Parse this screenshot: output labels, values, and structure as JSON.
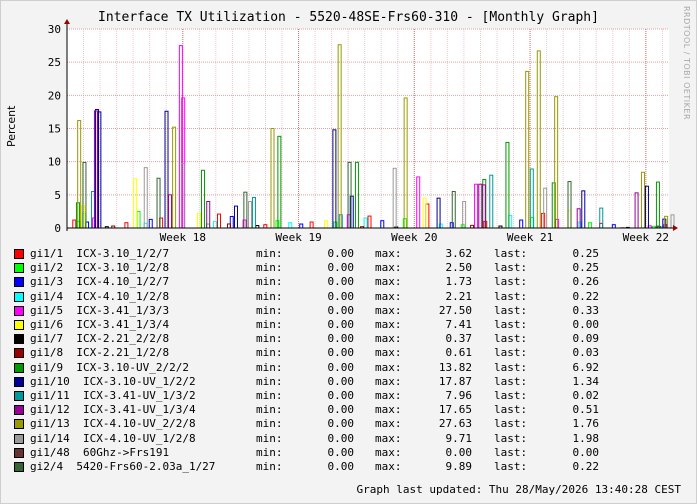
{
  "title": "Interface TX Utilization - 5520-48SE-Frs60-310 - [Monthly Graph]",
  "watermark": "RRDTOOL / TOBI OETIKER",
  "updated": "Graph last updated: Thu 28/May/2026 13:40:28 CEST",
  "chart_data": {
    "type": "bar",
    "ylabel": "Percent",
    "ylim": [
      0,
      30
    ],
    "yticks": [
      0,
      5,
      10,
      15,
      20,
      25,
      30
    ],
    "xlim": [
      17.0,
      22.2
    ],
    "xticks": [
      {
        "label": "Week 18",
        "pos": 18.0
      },
      {
        "label": "Week 19",
        "pos": 19.0
      },
      {
        "label": "Week 20",
        "pos": 20.0
      },
      {
        "label": "Week 21",
        "pos": 21.0
      },
      {
        "label": "Week 22",
        "pos": 22.0
      }
    ],
    "grid": true,
    "series": [
      {
        "name": "gi1/1  ICX-3.10_1/2/7",
        "color": "#ff0000",
        "stats": {
          "min": "0.00",
          "max": "3.62",
          "last": "0.25"
        },
        "points": [
          [
            17.05,
            1.2
          ],
          [
            17.5,
            0.8
          ],
          [
            17.8,
            1.5
          ],
          [
            18.3,
            2.1
          ],
          [
            18.7,
            0.5
          ],
          [
            19.1,
            0.9
          ],
          [
            19.6,
            1.8
          ],
          [
            20.1,
            3.62
          ],
          [
            20.6,
            1.0
          ],
          [
            21.1,
            2.2
          ],
          [
            21.6,
            0.7
          ],
          [
            22.1,
            0.25
          ]
        ]
      },
      {
        "name": "gi1/2  ICX-3.10_1/2/8",
        "color": "#00ff00",
        "stats": {
          "min": "0.00",
          "max": "2.50",
          "last": "0.25"
        },
        "points": [
          [
            17.08,
            1.0
          ],
          [
            17.6,
            2.5
          ],
          [
            18.2,
            0.6
          ],
          [
            18.8,
            1.1
          ],
          [
            19.3,
            0.9
          ],
          [
            19.9,
            1.4
          ],
          [
            20.4,
            0.5
          ],
          [
            21.0,
            1.6
          ],
          [
            21.5,
            0.8
          ],
          [
            22.05,
            0.25
          ]
        ]
      },
      {
        "name": "gi1/3  ICX-4.10_1/2/7",
        "color": "#0000ff",
        "stats": {
          "min": "0.00",
          "max": "1.73",
          "last": "0.26"
        },
        "points": [
          [
            17.15,
            0.9
          ],
          [
            17.7,
            1.3
          ],
          [
            18.4,
            1.73
          ],
          [
            19.0,
            0.6
          ],
          [
            19.7,
            1.1
          ],
          [
            20.3,
            0.8
          ],
          [
            20.9,
            1.2
          ],
          [
            21.7,
            0.5
          ],
          [
            22.08,
            0.26
          ]
        ]
      },
      {
        "name": "gi1/4  ICX-4.10_1/2/8",
        "color": "#00ffff",
        "stats": {
          "min": "0.00",
          "max": "2.21",
          "last": "0.22"
        },
        "points": [
          [
            17.12,
            2.21
          ],
          [
            17.65,
            0.7
          ],
          [
            18.25,
            1.0
          ],
          [
            18.9,
            0.8
          ],
          [
            19.55,
            1.5
          ],
          [
            20.2,
            0.6
          ],
          [
            20.8,
            1.9
          ],
          [
            21.4,
            0.9
          ],
          [
            22.12,
            0.22
          ]
        ]
      },
      {
        "name": "gi1/5  ICX-3.41_1/3/3",
        "color": "#ff00ff",
        "stats": {
          "min": "0.00",
          "max": "27.50",
          "last": "0.33"
        },
        "points": [
          [
            17.2,
            1.5
          ],
          [
            17.95,
            27.5
          ],
          [
            17.97,
            19.6
          ],
          [
            18.5,
            1.2
          ],
          [
            19.4,
            2.0
          ],
          [
            20.0,
            7.7
          ],
          [
            20.5,
            6.6
          ],
          [
            21.2,
            1.3
          ],
          [
            22.0,
            0.33
          ]
        ]
      },
      {
        "name": "gi1/6  ICX-3.41_1/3/4",
        "color": "#ffff00",
        "stats": {
          "min": "0.00",
          "max": "7.41",
          "last": "0.00"
        },
        "points": [
          [
            17.1,
            3.4
          ],
          [
            17.55,
            7.41
          ],
          [
            18.1,
            2.2
          ],
          [
            19.2,
            1.1
          ],
          [
            20.05,
            4.5
          ],
          [
            21.3,
            2.6
          ],
          [
            21.9,
            0.0
          ]
        ]
      },
      {
        "name": "gi1/7  ICX-2.21_2/2/8",
        "color": "#000000",
        "stats": {
          "min": "0.00",
          "max": "0.37",
          "last": "0.09"
        },
        "points": [
          [
            17.3,
            0.2
          ],
          [
            18.6,
            0.37
          ],
          [
            19.8,
            0.15
          ],
          [
            20.7,
            0.3
          ],
          [
            21.8,
            0.09
          ]
        ]
      },
      {
        "name": "gi1/8  ICX-2.21_1/2/8",
        "color": "#990000",
        "stats": {
          "min": "0.00",
          "max": "0.61",
          "last": "0.03"
        },
        "points": [
          [
            17.35,
            0.3
          ],
          [
            18.35,
            0.61
          ],
          [
            19.5,
            0.2
          ],
          [
            20.45,
            0.4
          ],
          [
            21.75,
            0.03
          ]
        ]
      },
      {
        "name": "gi1/9  ICX-3.10-UV_2/2/2",
        "color": "#009900",
        "stats": {
          "min": "0.00",
          "max": "13.82",
          "last": "6.92"
        },
        "points": [
          [
            17.04,
            3.8
          ],
          [
            18.12,
            8.7
          ],
          [
            18.78,
            13.82
          ],
          [
            19.45,
            9.9
          ],
          [
            20.55,
            7.3
          ],
          [
            20.75,
            12.9
          ],
          [
            21.15,
            6.8
          ],
          [
            22.05,
            6.92
          ]
        ]
      },
      {
        "name": "gi1/10  ICX-3.10-UV_1/2/2",
        "color": "#000099",
        "stats": {
          "min": "0.00",
          "max": "17.87",
          "last": "1.34",
          "": ""
        },
        "points": [
          [
            17.2,
            17.87
          ],
          [
            17.22,
            17.5
          ],
          [
            17.8,
            17.6
          ],
          [
            18.4,
            3.3
          ],
          [
            19.25,
            14.8
          ],
          [
            19.4,
            4.8
          ],
          [
            20.15,
            4.5
          ],
          [
            21.4,
            5.6
          ],
          [
            21.95,
            6.3
          ],
          [
            22.1,
            1.34
          ]
        ]
      },
      {
        "name": "gi1/11  ICX-3.41-UV_1/3/2",
        "color": "#009999",
        "stats": {
          "min": "0.00",
          "max": "7.96",
          "last": "0.02"
        },
        "points": [
          [
            17.16,
            5.5
          ],
          [
            18.55,
            4.6
          ],
          [
            19.3,
            2.0
          ],
          [
            20.6,
            7.96
          ],
          [
            20.95,
            8.9
          ],
          [
            21.55,
            3.0
          ],
          [
            22.15,
            0.02
          ]
        ]
      },
      {
        "name": "gi1/12  ICX-3.41-UV_1/3/4",
        "color": "#990099",
        "stats": {
          "min": "0.00",
          "max": "17.65",
          "last": "0.51"
        },
        "points": [
          [
            17.18,
            17.65
          ],
          [
            17.82,
            5.0
          ],
          [
            18.15,
            4.0
          ],
          [
            20.5,
            6.6
          ],
          [
            20.53,
            6.5
          ],
          [
            21.35,
            2.9
          ],
          [
            21.85,
            5.3
          ],
          [
            22.1,
            0.51
          ]
        ]
      },
      {
        "name": "gi1/13  ICX-4.10-UV_2/2/8",
        "color": "#999900",
        "stats": {
          "min": "0.00",
          "max": "27.63",
          "last": "1.76"
        },
        "points": [
          [
            17.03,
            16.2
          ],
          [
            17.85,
            15.2
          ],
          [
            18.7,
            15.0
          ],
          [
            19.28,
            27.63
          ],
          [
            19.85,
            19.6
          ],
          [
            20.9,
            23.6
          ],
          [
            21.0,
            26.7
          ],
          [
            21.15,
            19.8
          ],
          [
            21.9,
            8.4
          ],
          [
            22.1,
            1.76
          ]
        ]
      },
      {
        "name": "gi1/14  ICX-4.10-UV_1/2/8",
        "color": "#999999",
        "stats": {
          "min": "0.00",
          "max": "9.71",
          "last": "1.98"
        },
        "points": [
          [
            17.6,
            9.1
          ],
          [
            17.92,
            9.71
          ],
          [
            18.5,
            4.0
          ],
          [
            19.75,
            9.0
          ],
          [
            20.35,
            4.0
          ],
          [
            21.05,
            6.0
          ],
          [
            22.15,
            1.98
          ]
        ]
      },
      {
        "name": "gi1/48  60Ghz->Frs191",
        "color": "#663333",
        "stats": {
          "min": "0.00",
          "max": "0.00",
          "last": "0.00"
        },
        "points": []
      },
      {
        "name": "gi2/4  5420-Frs60-2.03a_1/27",
        "color": "#336633",
        "stats": {
          "min": "0.00",
          "max": "9.89",
          "last": "0.22"
        },
        "points": [
          [
            17.06,
            9.89
          ],
          [
            17.7,
            7.5
          ],
          [
            18.45,
            5.4
          ],
          [
            19.35,
            9.89
          ],
          [
            20.25,
            5.5
          ],
          [
            21.25,
            7.0
          ],
          [
            22.02,
            0.22
          ]
        ]
      }
    ]
  },
  "labels": {
    "min": "min:",
    "max": "max:",
    "last": "last:"
  }
}
